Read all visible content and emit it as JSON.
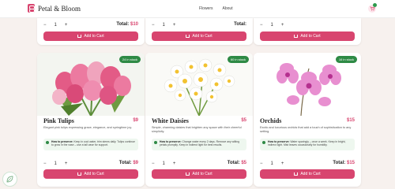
{
  "header": {
    "brand": "Petal & Bloom",
    "nav": [
      "Flowers",
      "About"
    ]
  },
  "top_cards": [
    {
      "qty": "1",
      "total_label": "Total:",
      "total": "$10",
      "add_label": "Add to Cart"
    },
    {
      "qty": "1",
      "total_label": "Total:",
      "total": "",
      "add_label": "Add to Cart"
    },
    {
      "qty": "1",
      "total_label": "",
      "total": "",
      "add_label": "Add to Cart"
    }
  ],
  "products": [
    {
      "stock": "24 in stock",
      "name": "Pink Tulips",
      "price": "$9",
      "description": "Elegant pink tulips expressing grace, elegance, and springtime joy.",
      "care_title": "How to preserve:",
      "care_text": "Keep in cool water, trim stems daily. Tulips continue to grow in the vase – use a tall vase for support.",
      "qty": "1",
      "total_label": "Total:",
      "total": "$9",
      "add_label": "Add to Cart"
    },
    {
      "stock": "60 in stock",
      "name": "White Daisies",
      "price": "$5",
      "description": "Simple, charming daisies that brighten any space with their cheerful simplicity.",
      "care_title": "How to preserve:",
      "care_text": "Change water every 2 days. Remove any wilting petals promptly. Keep in indirect light for best results.",
      "qty": "1",
      "total_label": "Total:",
      "total": "$5",
      "add_label": "Add to Cart"
    },
    {
      "stock": "16 in stock",
      "name": "Orchids",
      "price": "$15",
      "description": "Exotic and luxurious orchids that add a touch of sophistication to any setting.",
      "care_title": "How to preserve:",
      "care_text": "Water sparingly – once a week. Keep in bright, indirect light. Mist leaves occasionally for humidity.",
      "qty": "1",
      "total_label": "Total:",
      "total": "$15",
      "add_label": "Add to Cart"
    }
  ],
  "colors": {
    "accent": "#d8456f",
    "stock_badge": "#2e8a45"
  }
}
